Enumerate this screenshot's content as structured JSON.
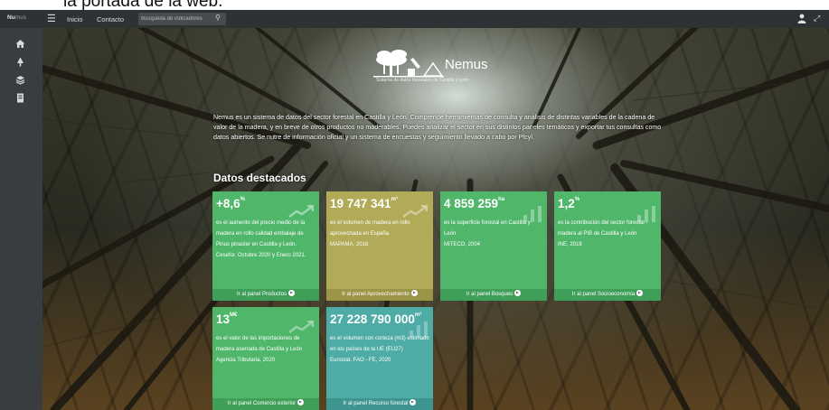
{
  "caption": "la portada de la web.",
  "topbar": {
    "brand_prefix": "Nu",
    "brand_suffix": "mus",
    "menu_icon": "hamburger-icon",
    "links": [
      "Inicio",
      "Contacto"
    ],
    "search_placeholder": "Búsqueda de indicadores",
    "search_icon": "search-icon",
    "user_icon": "user-icon",
    "expand_icon": "expand-icon"
  },
  "sidebar": {
    "icons": [
      "home-icon",
      "tree-icon",
      "layers-icon",
      "book-icon"
    ]
  },
  "header": {
    "title": "Nemus",
    "subtitle": "Sistema de datos forestales de Castilla y León"
  },
  "intro": "Nemus es un sistema de datos del sector forestal en Castilla y León. Comprende herramientas de consulta y análisis de distintas variables de la cadena de valor de la madera, y en breve de otros productos no maderables. Puedes analizar el sector en sus distintos paneles temáticos y exportar tus consultas como datos abiertos. Se nutre de información oficial y un sistema de encuestas y seguimiento llevado a cabo por Pfcyl.",
  "section_title": "Datos destacados",
  "cards": [
    {
      "value": "+8,6",
      "unit": "%",
      "description": "es el aumento del precio medio de la madera en rollo calidad embalaje de Pinus pinaster en Castilla y León.",
      "source": "Cesefor. Octubre 2020 y Enero 2021.",
      "link": "Ir al panel Productos",
      "color": "#4fb66a",
      "icon": "trend-up-icon"
    },
    {
      "value": "19 747 341",
      "unit": "m³",
      "description": "es el volumen de madera en rollo aprovechada en España",
      "source": "MAPAMA, 2018",
      "link": "Ir al panel Aprovechamiento",
      "color": "#b1aa57",
      "icon": "trend-up-icon"
    },
    {
      "value": "4 859 259",
      "unit": "ha",
      "description": "es la superficie forestal en Castilla y León",
      "source": "MITECO, 2004",
      "link": "Ir al panel Bosques",
      "color": "#4fb66a",
      "icon": "bar-chart-icon"
    },
    {
      "value": "1,2",
      "unit": "%",
      "description": "es la contribución del sector forestal - madera al PIB de Castilla y León",
      "source": "INE, 2018",
      "link": "Ir al panel Socioeconomía",
      "color": "#4fb66a",
      "icon": "bar-chart-icon"
    },
    {
      "value": "13",
      "unit": "M€",
      "description": "es el valor de las importaciones de madera aserrada de Castilla y León",
      "source": "Agencia Tributaria, 2020",
      "link": "Ir al panel Comercio exterior",
      "color": "#4fb66a",
      "icon": "trend-up-icon"
    },
    {
      "value": "27 228 790 000",
      "unit": "m³",
      "description": "es el volumen con corteza (m3) estimado en los países de la UE (EU27)",
      "source": "Eurostat. FAO - FE, 2020",
      "link": "Ir al panel Recurso forestal",
      "color": "#4eaba6",
      "icon": "bar-chart-icon"
    }
  ]
}
